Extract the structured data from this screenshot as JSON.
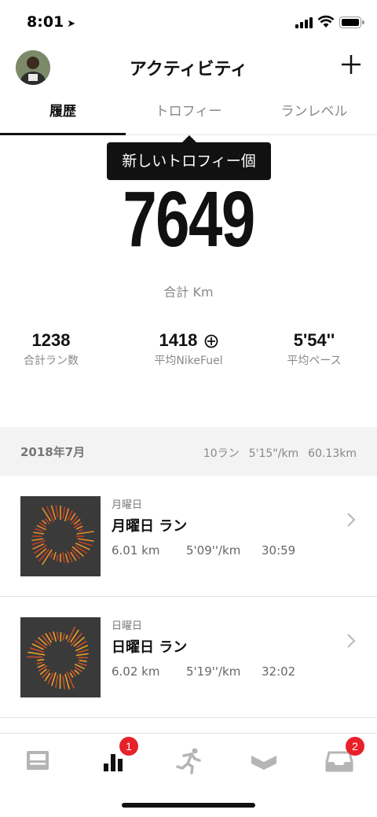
{
  "status_bar": {
    "time": "8:01",
    "location_arrow": "➤"
  },
  "header": {
    "title": "アクティビティ",
    "avatar_icon": "user-avatar",
    "add_icon": "plus-icon"
  },
  "tabs": [
    {
      "label": "履歴",
      "active": true
    },
    {
      "label": "トロフィー",
      "active": false
    },
    {
      "label": "ランレベル",
      "active": false
    }
  ],
  "tooltip": {
    "text": "新しいトロフィー個"
  },
  "totals": {
    "distance": "7649",
    "distance_label": "合計 Km",
    "stats": [
      {
        "value": "1238",
        "label": "合計ラン数"
      },
      {
        "value": "1418",
        "label": "平均NikeFuel",
        "icon": "nikefuel-icon"
      },
      {
        "value": "5'54''",
        "label": "平均ペース"
      }
    ]
  },
  "month": {
    "name": "2018年7月",
    "runs": "10ラン",
    "pace": "5'15\"/km",
    "distance": "60.13km"
  },
  "runs": [
    {
      "day": "月曜日",
      "title": "月曜日 ラン",
      "distance": "6.01 km",
      "pace": "5'09''/km",
      "duration": "30:59"
    },
    {
      "day": "日曜日",
      "title": "日曜日 ラン",
      "distance": "6.02 km",
      "pace": "5'19''/km",
      "duration": "32:02"
    }
  ],
  "bottom_nav": [
    {
      "icon": "feed-icon",
      "badge": ""
    },
    {
      "icon": "activity-bars-icon",
      "badge": "1"
    },
    {
      "icon": "runner-icon",
      "badge": ""
    },
    {
      "icon": "club-chevron-icon",
      "badge": ""
    },
    {
      "icon": "inbox-icon",
      "badge": "2"
    }
  ],
  "colors": {
    "badge": "#e8202a",
    "accent": "#111111",
    "band": "#f3f3f3"
  }
}
